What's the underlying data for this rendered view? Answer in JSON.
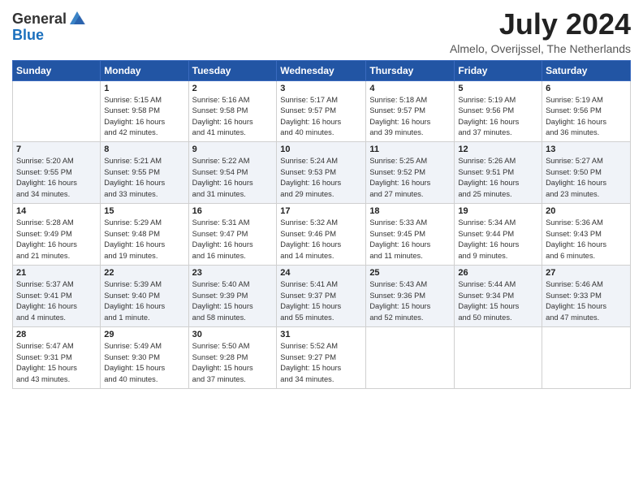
{
  "header": {
    "logo_general": "General",
    "logo_blue": "Blue",
    "title": "July 2024",
    "location": "Almelo, Overijssel, The Netherlands"
  },
  "weekdays": [
    "Sunday",
    "Monday",
    "Tuesday",
    "Wednesday",
    "Thursday",
    "Friday",
    "Saturday"
  ],
  "weeks": [
    [
      {
        "day": "",
        "detail": ""
      },
      {
        "day": "1",
        "detail": "Sunrise: 5:15 AM\nSunset: 9:58 PM\nDaylight: 16 hours\nand 42 minutes."
      },
      {
        "day": "2",
        "detail": "Sunrise: 5:16 AM\nSunset: 9:58 PM\nDaylight: 16 hours\nand 41 minutes."
      },
      {
        "day": "3",
        "detail": "Sunrise: 5:17 AM\nSunset: 9:57 PM\nDaylight: 16 hours\nand 40 minutes."
      },
      {
        "day": "4",
        "detail": "Sunrise: 5:18 AM\nSunset: 9:57 PM\nDaylight: 16 hours\nand 39 minutes."
      },
      {
        "day": "5",
        "detail": "Sunrise: 5:19 AM\nSunset: 9:56 PM\nDaylight: 16 hours\nand 37 minutes."
      },
      {
        "day": "6",
        "detail": "Sunrise: 5:19 AM\nSunset: 9:56 PM\nDaylight: 16 hours\nand 36 minutes."
      }
    ],
    [
      {
        "day": "7",
        "detail": "Sunrise: 5:20 AM\nSunset: 9:55 PM\nDaylight: 16 hours\nand 34 minutes."
      },
      {
        "day": "8",
        "detail": "Sunrise: 5:21 AM\nSunset: 9:55 PM\nDaylight: 16 hours\nand 33 minutes."
      },
      {
        "day": "9",
        "detail": "Sunrise: 5:22 AM\nSunset: 9:54 PM\nDaylight: 16 hours\nand 31 minutes."
      },
      {
        "day": "10",
        "detail": "Sunrise: 5:24 AM\nSunset: 9:53 PM\nDaylight: 16 hours\nand 29 minutes."
      },
      {
        "day": "11",
        "detail": "Sunrise: 5:25 AM\nSunset: 9:52 PM\nDaylight: 16 hours\nand 27 minutes."
      },
      {
        "day": "12",
        "detail": "Sunrise: 5:26 AM\nSunset: 9:51 PM\nDaylight: 16 hours\nand 25 minutes."
      },
      {
        "day": "13",
        "detail": "Sunrise: 5:27 AM\nSunset: 9:50 PM\nDaylight: 16 hours\nand 23 minutes."
      }
    ],
    [
      {
        "day": "14",
        "detail": "Sunrise: 5:28 AM\nSunset: 9:49 PM\nDaylight: 16 hours\nand 21 minutes."
      },
      {
        "day": "15",
        "detail": "Sunrise: 5:29 AM\nSunset: 9:48 PM\nDaylight: 16 hours\nand 19 minutes."
      },
      {
        "day": "16",
        "detail": "Sunrise: 5:31 AM\nSunset: 9:47 PM\nDaylight: 16 hours\nand 16 minutes."
      },
      {
        "day": "17",
        "detail": "Sunrise: 5:32 AM\nSunset: 9:46 PM\nDaylight: 16 hours\nand 14 minutes."
      },
      {
        "day": "18",
        "detail": "Sunrise: 5:33 AM\nSunset: 9:45 PM\nDaylight: 16 hours\nand 11 minutes."
      },
      {
        "day": "19",
        "detail": "Sunrise: 5:34 AM\nSunset: 9:44 PM\nDaylight: 16 hours\nand 9 minutes."
      },
      {
        "day": "20",
        "detail": "Sunrise: 5:36 AM\nSunset: 9:43 PM\nDaylight: 16 hours\nand 6 minutes."
      }
    ],
    [
      {
        "day": "21",
        "detail": "Sunrise: 5:37 AM\nSunset: 9:41 PM\nDaylight: 16 hours\nand 4 minutes."
      },
      {
        "day": "22",
        "detail": "Sunrise: 5:39 AM\nSunset: 9:40 PM\nDaylight: 16 hours\nand 1 minute."
      },
      {
        "day": "23",
        "detail": "Sunrise: 5:40 AM\nSunset: 9:39 PM\nDaylight: 15 hours\nand 58 minutes."
      },
      {
        "day": "24",
        "detail": "Sunrise: 5:41 AM\nSunset: 9:37 PM\nDaylight: 15 hours\nand 55 minutes."
      },
      {
        "day": "25",
        "detail": "Sunrise: 5:43 AM\nSunset: 9:36 PM\nDaylight: 15 hours\nand 52 minutes."
      },
      {
        "day": "26",
        "detail": "Sunrise: 5:44 AM\nSunset: 9:34 PM\nDaylight: 15 hours\nand 50 minutes."
      },
      {
        "day": "27",
        "detail": "Sunrise: 5:46 AM\nSunset: 9:33 PM\nDaylight: 15 hours\nand 47 minutes."
      }
    ],
    [
      {
        "day": "28",
        "detail": "Sunrise: 5:47 AM\nSunset: 9:31 PM\nDaylight: 15 hours\nand 43 minutes."
      },
      {
        "day": "29",
        "detail": "Sunrise: 5:49 AM\nSunset: 9:30 PM\nDaylight: 15 hours\nand 40 minutes."
      },
      {
        "day": "30",
        "detail": "Sunrise: 5:50 AM\nSunset: 9:28 PM\nDaylight: 15 hours\nand 37 minutes."
      },
      {
        "day": "31",
        "detail": "Sunrise: 5:52 AM\nSunset: 9:27 PM\nDaylight: 15 hours\nand 34 minutes."
      },
      {
        "day": "",
        "detail": ""
      },
      {
        "day": "",
        "detail": ""
      },
      {
        "day": "",
        "detail": ""
      }
    ]
  ]
}
